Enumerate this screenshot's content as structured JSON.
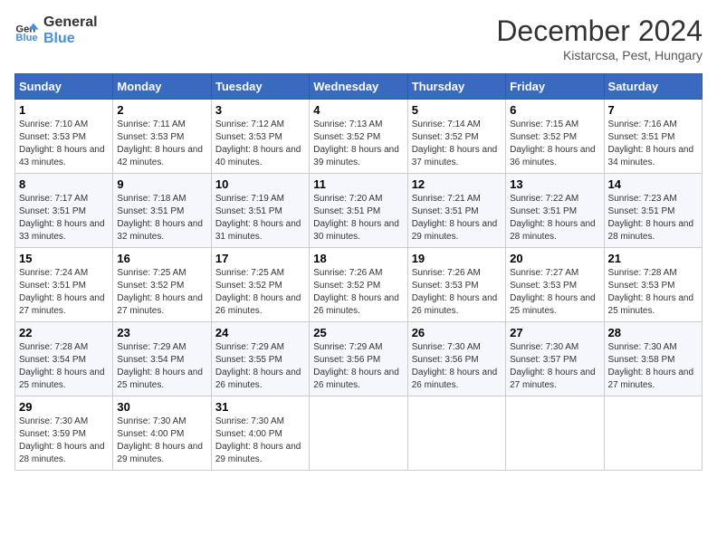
{
  "logo": {
    "line1": "General",
    "line2": "Blue"
  },
  "title": "December 2024",
  "location": "Kistarcsa, Pest, Hungary",
  "days_of_week": [
    "Sunday",
    "Monday",
    "Tuesday",
    "Wednesday",
    "Thursday",
    "Friday",
    "Saturday"
  ],
  "weeks": [
    [
      {
        "day": 1,
        "sunrise": "7:10 AM",
        "sunset": "3:53 PM",
        "daylight": "8 hours and 43 minutes."
      },
      {
        "day": 2,
        "sunrise": "7:11 AM",
        "sunset": "3:53 PM",
        "daylight": "8 hours and 42 minutes."
      },
      {
        "day": 3,
        "sunrise": "7:12 AM",
        "sunset": "3:53 PM",
        "daylight": "8 hours and 40 minutes."
      },
      {
        "day": 4,
        "sunrise": "7:13 AM",
        "sunset": "3:52 PM",
        "daylight": "8 hours and 39 minutes."
      },
      {
        "day": 5,
        "sunrise": "7:14 AM",
        "sunset": "3:52 PM",
        "daylight": "8 hours and 37 minutes."
      },
      {
        "day": 6,
        "sunrise": "7:15 AM",
        "sunset": "3:52 PM",
        "daylight": "8 hours and 36 minutes."
      },
      {
        "day": 7,
        "sunrise": "7:16 AM",
        "sunset": "3:51 PM",
        "daylight": "8 hours and 34 minutes."
      }
    ],
    [
      {
        "day": 8,
        "sunrise": "7:17 AM",
        "sunset": "3:51 PM",
        "daylight": "8 hours and 33 minutes."
      },
      {
        "day": 9,
        "sunrise": "7:18 AM",
        "sunset": "3:51 PM",
        "daylight": "8 hours and 32 minutes."
      },
      {
        "day": 10,
        "sunrise": "7:19 AM",
        "sunset": "3:51 PM",
        "daylight": "8 hours and 31 minutes."
      },
      {
        "day": 11,
        "sunrise": "7:20 AM",
        "sunset": "3:51 PM",
        "daylight": "8 hours and 30 minutes."
      },
      {
        "day": 12,
        "sunrise": "7:21 AM",
        "sunset": "3:51 PM",
        "daylight": "8 hours and 29 minutes."
      },
      {
        "day": 13,
        "sunrise": "7:22 AM",
        "sunset": "3:51 PM",
        "daylight": "8 hours and 28 minutes."
      },
      {
        "day": 14,
        "sunrise": "7:23 AM",
        "sunset": "3:51 PM",
        "daylight": "8 hours and 28 minutes."
      }
    ],
    [
      {
        "day": 15,
        "sunrise": "7:24 AM",
        "sunset": "3:51 PM",
        "daylight": "8 hours and 27 minutes."
      },
      {
        "day": 16,
        "sunrise": "7:25 AM",
        "sunset": "3:52 PM",
        "daylight": "8 hours and 27 minutes."
      },
      {
        "day": 17,
        "sunrise": "7:25 AM",
        "sunset": "3:52 PM",
        "daylight": "8 hours and 26 minutes."
      },
      {
        "day": 18,
        "sunrise": "7:26 AM",
        "sunset": "3:52 PM",
        "daylight": "8 hours and 26 minutes."
      },
      {
        "day": 19,
        "sunrise": "7:26 AM",
        "sunset": "3:53 PM",
        "daylight": "8 hours and 26 minutes."
      },
      {
        "day": 20,
        "sunrise": "7:27 AM",
        "sunset": "3:53 PM",
        "daylight": "8 hours and 25 minutes."
      },
      {
        "day": 21,
        "sunrise": "7:28 AM",
        "sunset": "3:53 PM",
        "daylight": "8 hours and 25 minutes."
      }
    ],
    [
      {
        "day": 22,
        "sunrise": "7:28 AM",
        "sunset": "3:54 PM",
        "daylight": "8 hours and 25 minutes."
      },
      {
        "day": 23,
        "sunrise": "7:29 AM",
        "sunset": "3:54 PM",
        "daylight": "8 hours and 25 minutes."
      },
      {
        "day": 24,
        "sunrise": "7:29 AM",
        "sunset": "3:55 PM",
        "daylight": "8 hours and 26 minutes."
      },
      {
        "day": 25,
        "sunrise": "7:29 AM",
        "sunset": "3:56 PM",
        "daylight": "8 hours and 26 minutes."
      },
      {
        "day": 26,
        "sunrise": "7:30 AM",
        "sunset": "3:56 PM",
        "daylight": "8 hours and 26 minutes."
      },
      {
        "day": 27,
        "sunrise": "7:30 AM",
        "sunset": "3:57 PM",
        "daylight": "8 hours and 27 minutes."
      },
      {
        "day": 28,
        "sunrise": "7:30 AM",
        "sunset": "3:58 PM",
        "daylight": "8 hours and 27 minutes."
      }
    ],
    [
      {
        "day": 29,
        "sunrise": "7:30 AM",
        "sunset": "3:59 PM",
        "daylight": "8 hours and 28 minutes."
      },
      {
        "day": 30,
        "sunrise": "7:30 AM",
        "sunset": "4:00 PM",
        "daylight": "8 hours and 29 minutes."
      },
      {
        "day": 31,
        "sunrise": "7:30 AM",
        "sunset": "4:00 PM",
        "daylight": "8 hours and 29 minutes."
      },
      null,
      null,
      null,
      null
    ]
  ],
  "labels": {
    "sunrise": "Sunrise:",
    "sunset": "Sunset:",
    "daylight": "Daylight:"
  }
}
